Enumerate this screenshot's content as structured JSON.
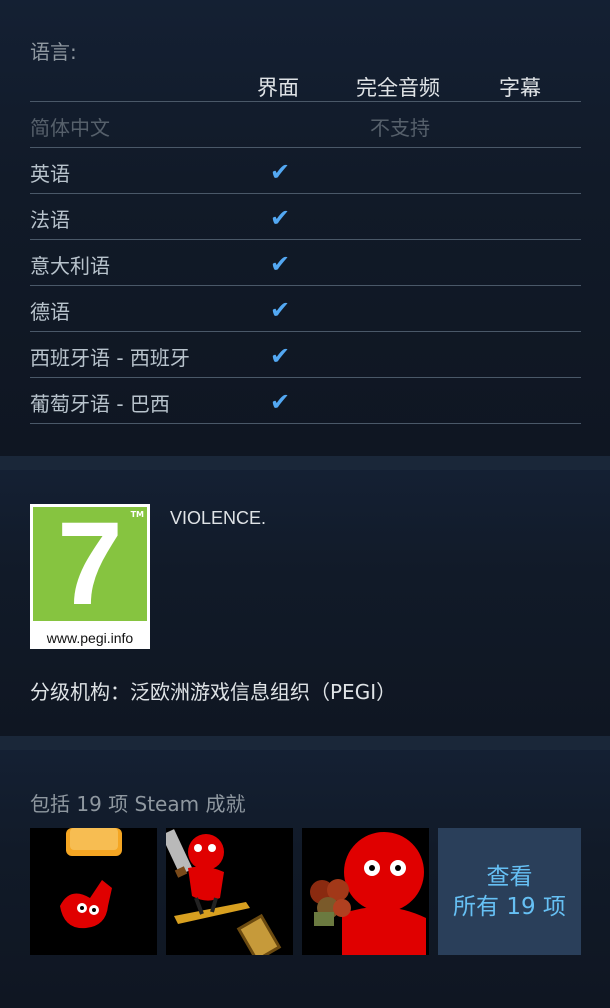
{
  "languages": {
    "title": "语言:",
    "columns": [
      "界面",
      "完全音频",
      "字幕"
    ],
    "rows": [
      {
        "name": "简体中文",
        "unsupported_label": "不支持",
        "interface": false
      },
      {
        "name": "英语",
        "interface": true
      },
      {
        "name": "法语",
        "interface": true
      },
      {
        "name": "意大利语",
        "interface": true
      },
      {
        "name": "德语",
        "interface": true
      },
      {
        "name": "西班牙语 - 西班牙",
        "interface": true
      },
      {
        "name": "葡萄牙语 - 巴西",
        "interface": true
      }
    ],
    "check_glyph": "✔"
  },
  "rating": {
    "age": "7",
    "tm": "TM",
    "site": "www.pegi.info",
    "descriptor": "VIOLENCE.",
    "agency": "分级机构：泛欧洲游戏信息组织（PEGI）"
  },
  "achievements": {
    "title": "包括 19 项 Steam 成就",
    "tiles": [
      "achievement-icon-1",
      "achievement-icon-2",
      "achievement-icon-3"
    ],
    "view_all_line1": "查看",
    "view_all_line2": "所有 19 项"
  },
  "colors": {
    "background": "#0f1622",
    "check": "#53a8f2",
    "pegi_green": "#86c440",
    "creature_red": "#e00000",
    "view_all_bg": "#2a3f5a",
    "view_all_text": "#66c0f4"
  }
}
